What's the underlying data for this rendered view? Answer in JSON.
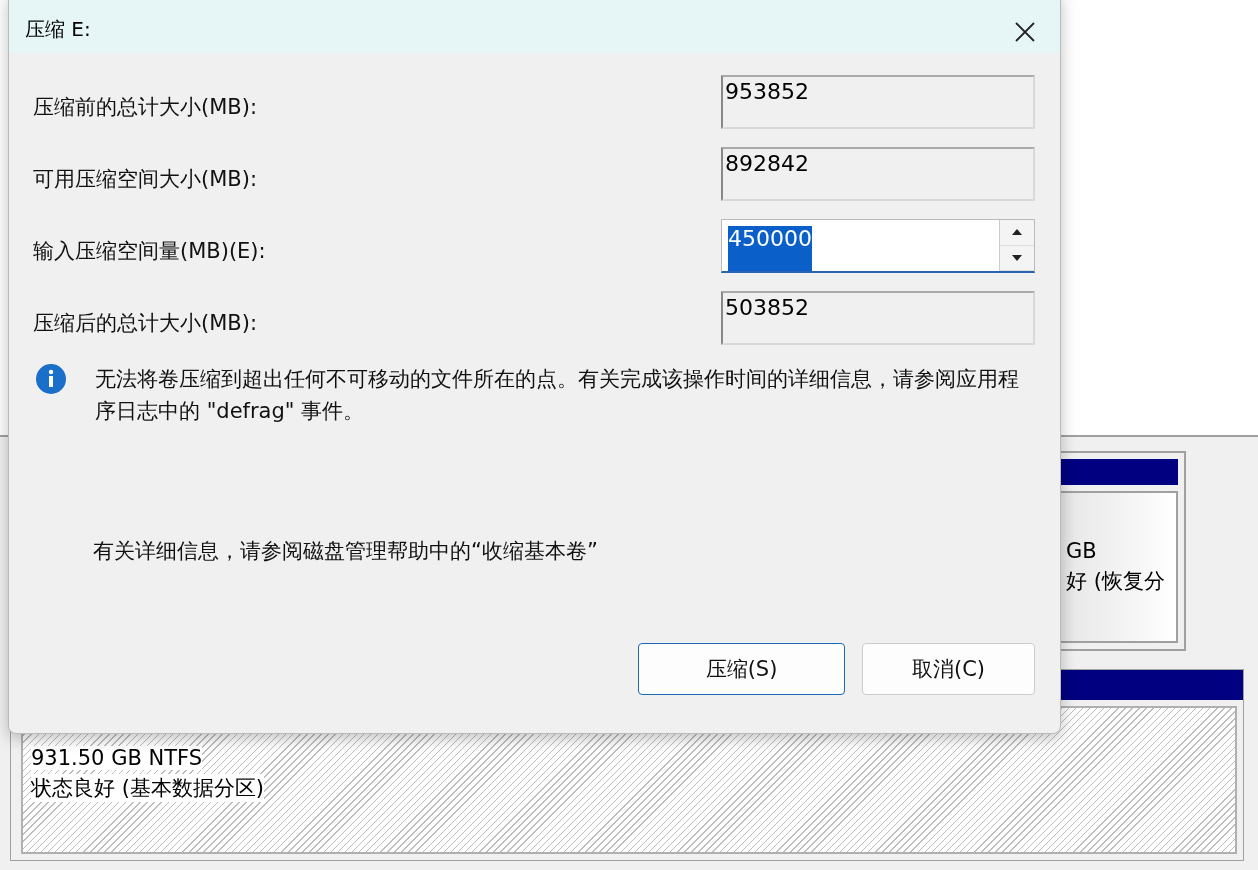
{
  "background": {
    "recovery_partition": {
      "size": "GB",
      "status": "好 (恢复分"
    },
    "data_partition": {
      "size": "931.50 GB NTFS",
      "status": "状态良好 (基本数据分区)"
    }
  },
  "dialog": {
    "title": "压缩 E:",
    "fields": [
      {
        "label": "压缩前的总计大小(MB):",
        "value": "953852",
        "kind": "readonly",
        "text_selected": false
      },
      {
        "label": "可用压缩空间大小(MB):",
        "value": "892842",
        "kind": "readonly",
        "text_selected": false
      },
      {
        "label": "输入压缩空间量(MB)(E):",
        "value": "450000",
        "kind": "spinner",
        "text_selected": true
      },
      {
        "label": "压缩后的总计大小(MB):",
        "value": "503852",
        "kind": "readonly",
        "text_selected": false
      }
    ],
    "info": "无法将卷压缩到超出任何不可移动的文件所在的点。有关完成该操作时间的详细信息，请参阅应用程序日志中的 \"defrag\" 事件。",
    "help": "有关详细信息，请参阅磁盘管理帮助中的“收缩基本卷”",
    "buttons": [
      {
        "label": "压缩(S)",
        "default": true
      },
      {
        "label": "取消(C)",
        "default": false
      }
    ]
  }
}
